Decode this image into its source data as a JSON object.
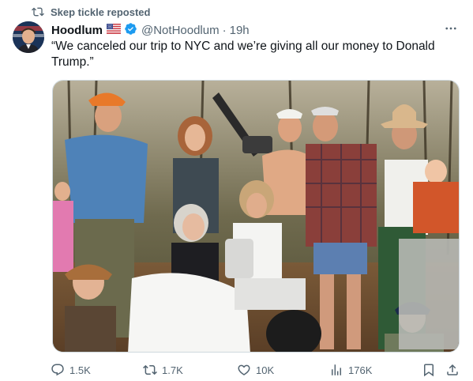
{
  "repost": {
    "text": "Skep tickle reposted",
    "icon": "repost-icon"
  },
  "author": {
    "name": "Hoodlum",
    "flag": "us-flag-icon",
    "verified": "verified-badge-icon",
    "handle": "@NotHoodlum",
    "separator": "·",
    "time": "19h"
  },
  "tweet": {
    "text": "“We canceled our trip to NYC and we’re giving all our money to Donald Trump.”"
  },
  "media": {
    "description_icon": "photo"
  },
  "actions": {
    "reply": {
      "icon": "reply-icon",
      "count": "1.5K"
    },
    "repost": {
      "icon": "repost-icon",
      "count": "1.7K"
    },
    "like": {
      "icon": "heart-icon",
      "count": "10K"
    },
    "views": {
      "icon": "views-icon",
      "count": "176K"
    },
    "bookmark": {
      "icon": "bookmark-icon"
    },
    "share": {
      "icon": "share-icon"
    }
  },
  "colors": {
    "text": "#0f1419",
    "secondary": "#536471",
    "verified": "#1d9bf0",
    "border": "#cfd9de"
  }
}
